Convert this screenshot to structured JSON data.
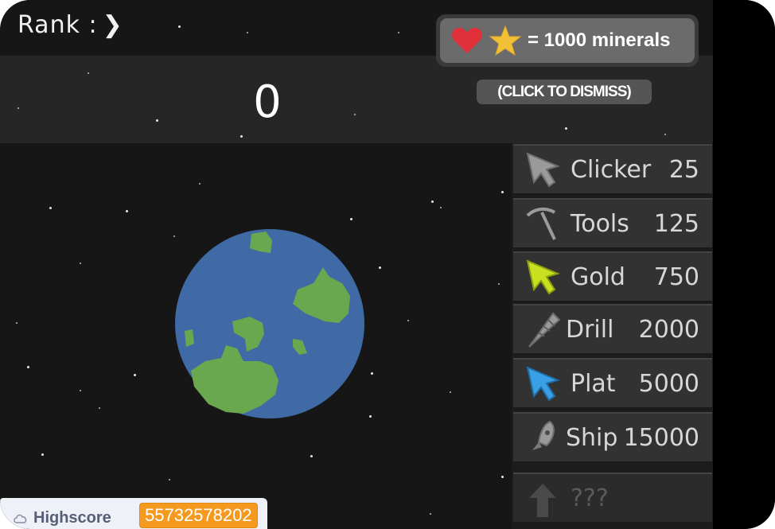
{
  "rank": {
    "label": "Rank :",
    "chevron": "❯"
  },
  "score": "0",
  "notice": {
    "text": "= 1000 minerals",
    "dismiss_label": "(CLICK TO DISMISS)",
    "icons": [
      "heart-icon",
      "star-icon"
    ],
    "heart_color": "#e0303a",
    "star_color": "#f2c037"
  },
  "shop": {
    "items": [
      {
        "name": "Clicker",
        "price": "25",
        "icon": "cursor-icon",
        "color": "#9a9a9a"
      },
      {
        "name": "Tools",
        "price": "125",
        "icon": "pickaxe-icon",
        "color": "#9a9a9a"
      },
      {
        "name": "Gold",
        "price": "750",
        "icon": "gold-cursor-icon",
        "color": "#c8e020"
      },
      {
        "name": "Drill",
        "price": "2000",
        "icon": "drill-icon",
        "color": "#9a9a9a"
      },
      {
        "name": "Plat",
        "price": "5000",
        "icon": "plat-cursor-icon",
        "color": "#3aa0e6"
      },
      {
        "name": "Ship",
        "price": "15000",
        "icon": "rocket-icon",
        "color": "#9a9a9a"
      },
      {
        "name": "???",
        "price": "",
        "icon": "up-arrow-icon",
        "color": "#4a4a4a"
      }
    ]
  },
  "highscore": {
    "label": "Highscore",
    "value": "55732578202"
  },
  "colors": {
    "background": "#161616",
    "panel": "#262626",
    "planet_ocean": "#3f6aa6",
    "planet_land": "#6aa84f",
    "highscore_badge": "#f59a1f"
  }
}
